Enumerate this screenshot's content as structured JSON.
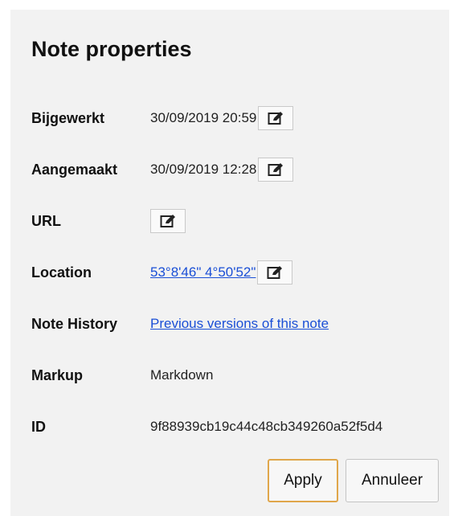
{
  "dialog": {
    "title": "Note properties",
    "fields": {
      "updated": {
        "label": "Bijgewerkt",
        "value": "30/09/2019 20:59"
      },
      "created": {
        "label": "Aangemaakt",
        "value": "30/09/2019 12:28"
      },
      "url": {
        "label": "URL",
        "value": ""
      },
      "location": {
        "label": "Location",
        "value": "53°8'46\" 4°50'52\""
      },
      "history": {
        "label": "Note History",
        "value": "Previous versions of this note"
      },
      "markup": {
        "label": "Markup",
        "value": "Markdown"
      },
      "id": {
        "label": "ID",
        "value": "9f88939cb19c44c48cb349260a52f5d4"
      }
    },
    "buttons": {
      "apply": "Apply",
      "cancel": "Annuleer"
    },
    "icons": {
      "edit": "edit-icon"
    },
    "colors": {
      "link": "#1a4fd6",
      "apply_border": "#e0a64a",
      "background": "#f2f2f2"
    }
  }
}
